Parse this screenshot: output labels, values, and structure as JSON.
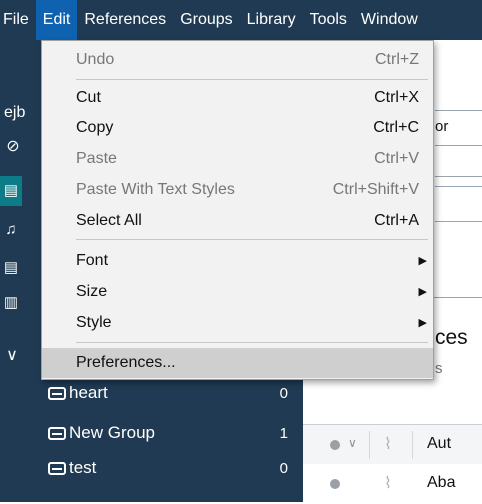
{
  "menubar": {
    "items": [
      "File",
      "Edit",
      "References",
      "Groups",
      "Library",
      "Tools",
      "Window"
    ]
  },
  "edit_menu": {
    "undo": {
      "label": "Undo",
      "shortcut": "Ctrl+Z"
    },
    "cut": {
      "label": "Cut",
      "shortcut": "Ctrl+X"
    },
    "copy": {
      "label": "Copy",
      "shortcut": "Ctrl+C"
    },
    "paste": {
      "label": "Paste",
      "shortcut": "Ctrl+V"
    },
    "paste_styles": {
      "label": "Paste With Text Styles",
      "shortcut": "Ctrl+Shift+V"
    },
    "select_all": {
      "label": "Select All",
      "shortcut": "Ctrl+A"
    },
    "font": {
      "label": "Font"
    },
    "size": {
      "label": "Size"
    },
    "style": {
      "label": "Style"
    },
    "preferences": {
      "label": "Preferences..."
    }
  },
  "sidebar": {
    "account_abbr": "ejb",
    "groups": [
      {
        "name": "heart",
        "count": "0"
      },
      {
        "name": "New Group",
        "count": "1"
      },
      {
        "name": "test",
        "count": "0"
      }
    ]
  },
  "content": {
    "field_fragment": "or",
    "heading_fragment": "ces",
    "subheading_fragment": "s",
    "col_author_fragment": "Aut",
    "col_abstract_fragment": "Aba"
  },
  "colors": {
    "sidebar_bg": "#1f3a52",
    "menu_active": "#0e62b0",
    "menu_bg": "#f2f2f2",
    "hover": "#cfcfcf",
    "teal_highlight": "#0e7c86"
  }
}
